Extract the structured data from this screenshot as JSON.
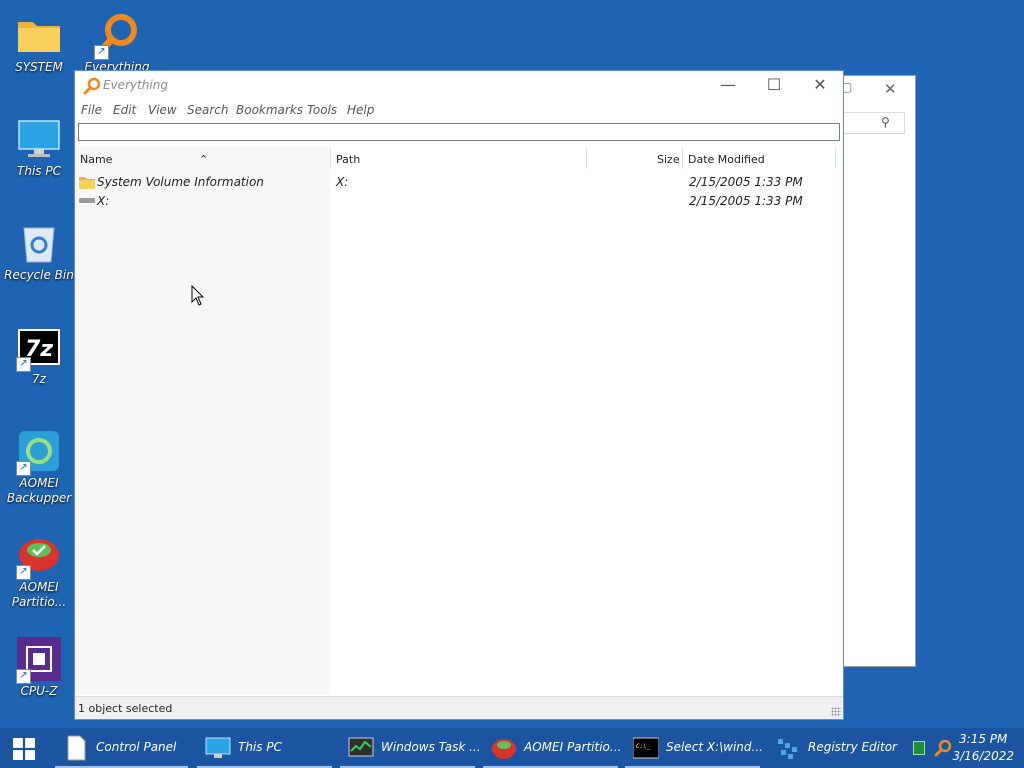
{
  "desktop": {
    "icons": [
      {
        "label": "SYSTEM",
        "icon": "folder-icon"
      },
      {
        "label": "Everything",
        "icon": "everything-icon"
      },
      {
        "label": "This PC",
        "icon": "monitor-icon"
      },
      {
        "label": "Recycle Bin",
        "icon": "recycle-bin-icon"
      },
      {
        "label": "7z",
        "icon": "7z-icon"
      },
      {
        "label": "AOMEI Backupper",
        "icon": "aomei-backupper-icon"
      },
      {
        "label": "AOMEI Partitio...",
        "icon": "aomei-partition-icon"
      },
      {
        "label": "CPU-Z",
        "icon": "cpuz-icon"
      }
    ]
  },
  "window": {
    "title": "Everything",
    "menu": [
      "File",
      "Edit",
      "View",
      "Search",
      "Bookmarks",
      "Tools",
      "Help"
    ],
    "search_value": "",
    "columns": {
      "name": "Name",
      "path": "Path",
      "size": "Size",
      "date": "Date Modified"
    },
    "rows": [
      {
        "name": "System Volume Information",
        "path": "X:",
        "size": "",
        "date": "2/15/2005 1:33 PM",
        "icon": "folder-icon"
      },
      {
        "name": "X:",
        "path": "",
        "size": "",
        "date": "2/15/2005 1:33 PM",
        "icon": "drive-icon"
      }
    ],
    "status": "1 object selected"
  },
  "taskbar": {
    "items": [
      {
        "label": "Control Panel",
        "icon": "document-icon"
      },
      {
        "label": "This PC",
        "icon": "monitor-icon"
      },
      {
        "label": "Windows Task ...",
        "icon": "task-manager-icon"
      },
      {
        "label": "AOMEI Partitio...",
        "icon": "aomei-partition-icon"
      },
      {
        "label": "Select X:\\wind...",
        "icon": "cmd-icon"
      },
      {
        "label": "Registry Editor",
        "icon": "registry-icon"
      }
    ],
    "time": "3:15 PM",
    "date": "3/16/2022"
  },
  "colors": {
    "desktop": "#1f63b3",
    "taskbar": "#1b55a1",
    "everything_orange": "#f08a1c"
  }
}
